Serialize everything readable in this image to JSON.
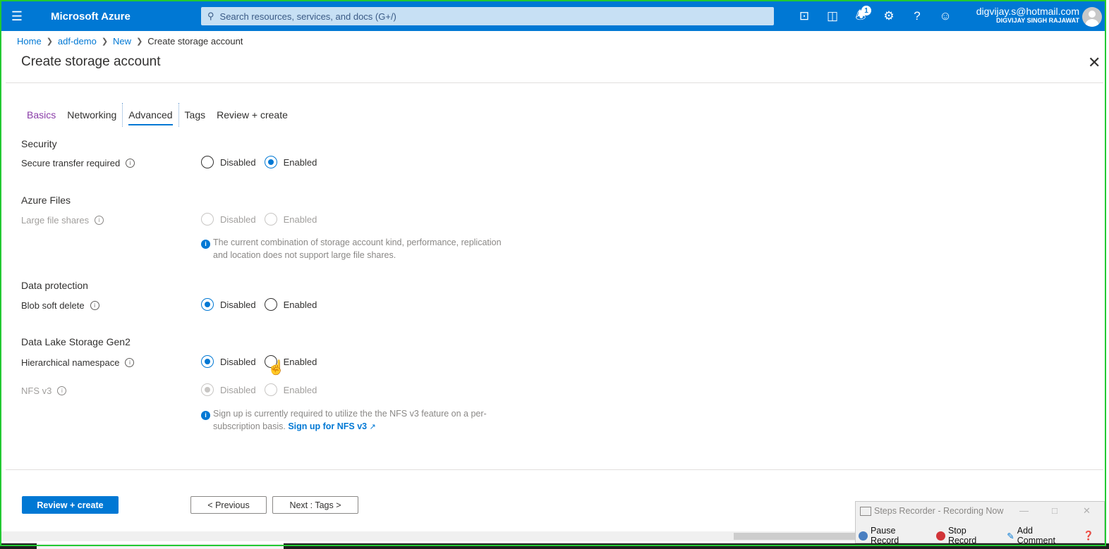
{
  "topbar": {
    "brand": "Microsoft Azure",
    "search_placeholder": "Search resources, services, and docs (G+/)",
    "notification_count": "1",
    "account_email": "digvijay.s@hotmail.com",
    "account_name": "DIGVIJAY SINGH RAJAWAT",
    "icons": [
      "cloud-shell-icon",
      "directory-filter-icon",
      "notifications-icon",
      "settings-icon",
      "help-icon",
      "feedback-icon"
    ]
  },
  "breadcrumb": {
    "home": "Home",
    "rg": "adf-demo",
    "new": "New",
    "current": "Create storage account"
  },
  "page": {
    "title": "Create storage account"
  },
  "tabs": [
    "Basics",
    "Networking",
    "Advanced",
    "Tags",
    "Review + create"
  ],
  "form": {
    "security": {
      "heading": "Security",
      "secure_transfer_label": "Secure transfer required",
      "disabled": "Disabled",
      "enabled": "Enabled",
      "selected": "Enabled"
    },
    "azure_files": {
      "heading": "Azure Files",
      "large_file_label": "Large file shares",
      "disabled": "Disabled",
      "enabled": "Enabled",
      "note_line1": "The current combination of storage account kind, performance, replication",
      "note_line2": "and location does not support large file shares."
    },
    "data_protection": {
      "heading": "Data protection",
      "blob_soft_delete_label": "Blob soft delete",
      "disabled": "Disabled",
      "enabled": "Enabled",
      "selected": "Disabled"
    },
    "data_lake": {
      "heading": "Data Lake Storage Gen2",
      "hns_label": "Hierarchical namespace",
      "nfs_label": "NFS v3",
      "disabled": "Disabled",
      "enabled": "Enabled",
      "hns_selected": "Disabled",
      "nfs_selected": "Disabled",
      "note_line1": "Sign up is currently required to utilize the the NFS v3 feature on a per-",
      "note_line2": "subscription basis.",
      "note_link": "Sign up for NFS v3"
    }
  },
  "footer": {
    "review_create": "Review + create",
    "previous": "< Previous",
    "next": "Next : Tags >"
  },
  "steps_recorder": {
    "title": "Steps Recorder - Recording Now",
    "pause": "Pause Record",
    "stop": "Stop Record",
    "comment": "Add Comment"
  }
}
